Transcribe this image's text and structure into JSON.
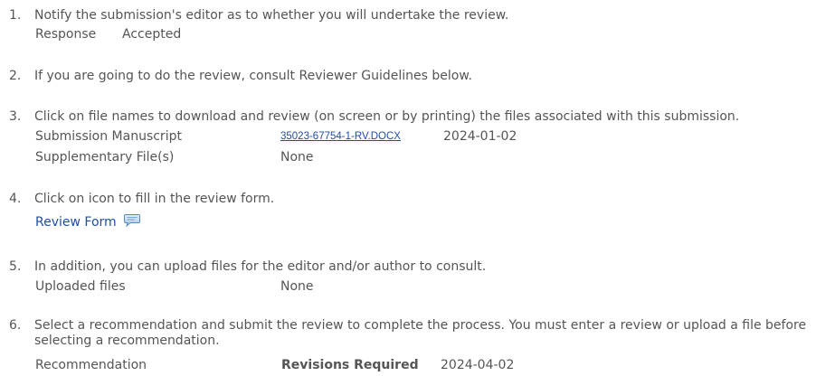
{
  "steps": [
    {
      "number": "1.",
      "text": "Notify the submission's editor as to whether you will undertake the review.",
      "response_label": "Response",
      "response_value": "Accepted"
    },
    {
      "number": "2.",
      "text": "If you are going to do the review, consult Reviewer Guidelines below."
    },
    {
      "number": "3.",
      "text": "Click on file names to download and review (on screen or by printing) the files associated with this submission.",
      "manuscript_label": "Submission Manuscript",
      "manuscript_file": "35023-67754-1-RV.DOCX",
      "manuscript_date": "2024-01-02",
      "supplementary_label": "Supplementary File(s)",
      "supplementary_value": "None"
    },
    {
      "number": "4.",
      "text": "Click on icon to fill in the review form.",
      "review_form_link": "Review Form",
      "icon": "comment-bubble-icon"
    },
    {
      "number": "5.",
      "text": "In addition, you can upload files for the editor and/or author to consult.",
      "uploaded_label": "Uploaded files",
      "uploaded_value": "None"
    },
    {
      "number": "6.",
      "text": "Select a recommendation and submit the review to complete the process. You must enter a review or upload a file before selecting a recommendation.",
      "recommendation_label": "Recommendation",
      "recommendation_value": "Revisions Required",
      "recommendation_date": "2024-04-02"
    }
  ],
  "colors": {
    "text": "#555555",
    "link": "#1f4ea3",
    "icon_fill": "#bcd3ee",
    "icon_stroke": "#5b86c4"
  }
}
